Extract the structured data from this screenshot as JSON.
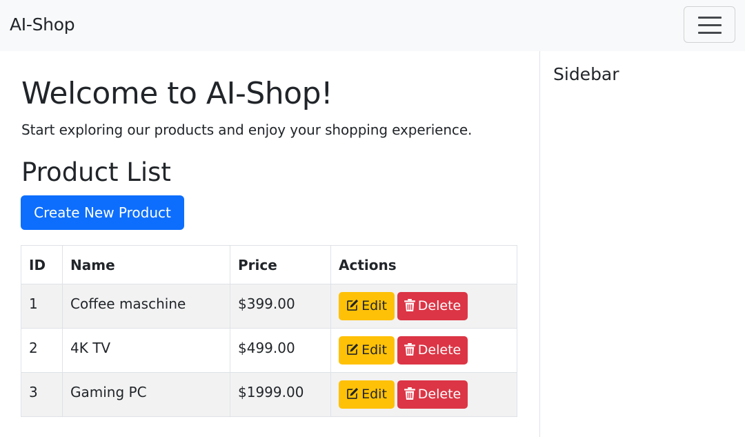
{
  "navbar": {
    "brand": "AI-Shop",
    "toggler_icon": "hamburger-menu-icon"
  },
  "main": {
    "welcome_title": "Welcome to AI-Shop!",
    "welcome_text": "Start exploring our products and enjoy your shopping experience.",
    "section_title": "Product List",
    "create_button": "Create New Product"
  },
  "table": {
    "headers": [
      "ID",
      "Name",
      "Price",
      "Actions"
    ],
    "rows": [
      {
        "id": "1",
        "name": "Coffee maschine",
        "price": "$399.00"
      },
      {
        "id": "2",
        "name": "4K TV",
        "price": "$499.00"
      },
      {
        "id": "3",
        "name": "Gaming PC",
        "price": "$1999.00"
      }
    ],
    "edit_label": "Edit",
    "delete_label": "Delete",
    "edit_icon": "edit-icon",
    "delete_icon": "trash-icon"
  },
  "sidebar": {
    "title": "Sidebar"
  },
  "colors": {
    "primary": "#0d6efd",
    "warning": "#ffc107",
    "danger": "#dc3545",
    "navbar_bg": "#f8f9fa"
  }
}
